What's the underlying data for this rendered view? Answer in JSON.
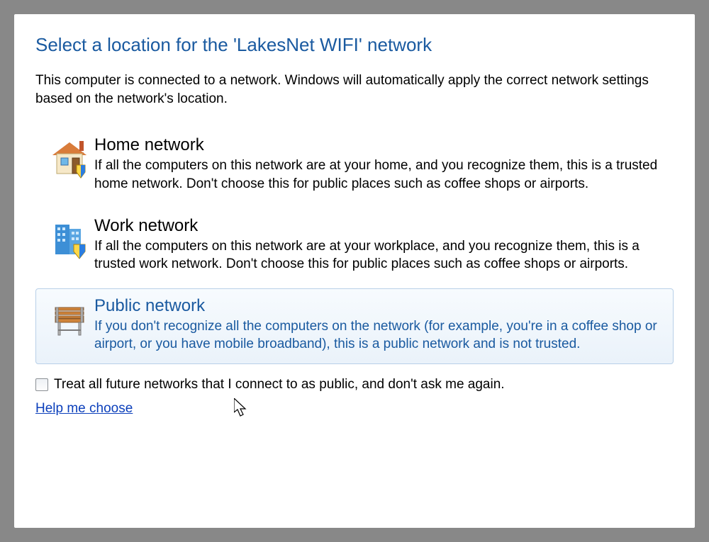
{
  "title": "Select a location for the 'LakesNet WIFI' network",
  "intro": "This computer is connected to a network. Windows will automatically apply the correct network settings based on the network's location.",
  "options": [
    {
      "title": "Home network",
      "description": "If all the computers on this network are at your home, and you recognize them, this is a trusted home network.  Don't choose this for public places such as coffee shops or airports."
    },
    {
      "title": "Work network",
      "description": "If all the computers on this network are at your workplace, and you recognize them, this is a trusted work network.  Don't choose this for public places such as coffee shops or airports."
    },
    {
      "title": "Public network",
      "description": "If you don't recognize all the computers on the network (for example, you're in a coffee shop or airport, or you have mobile broadband), this is a public network and is not trusted."
    }
  ],
  "checkbox_label": "Treat all future networks that I connect to as public, and don't ask me again.",
  "help_link": "Help me choose"
}
